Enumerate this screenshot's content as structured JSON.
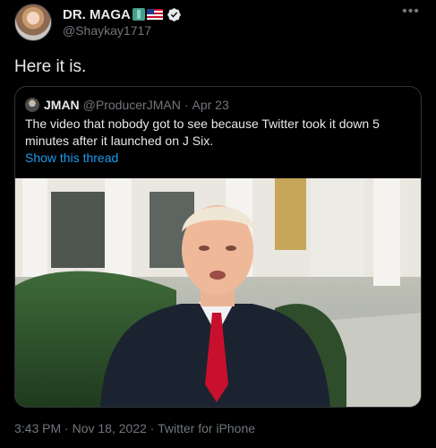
{
  "author": {
    "display_name": "DR. MAGA",
    "handle": "@Shaykay1717"
  },
  "tweet": {
    "text": "Here it is."
  },
  "quoted": {
    "name": "JMAN",
    "handle": "@ProducerJMAN",
    "separator": "·",
    "date": "Apr 23",
    "text": "The video that nobody got to see because Twitter took it down 5 minutes after it launched on J Six.",
    "show_thread": "Show this thread"
  },
  "meta": {
    "time": "3:43 PM",
    "separator": " · ",
    "date": "Nov 18, 2022",
    "source": "Twitter for iPhone"
  },
  "icons": {
    "more": "more-horizontal-icon",
    "verified": "verified-badge-icon",
    "flags": [
      "statue-of-liberty-icon",
      "us-flag-icon"
    ]
  },
  "colors": {
    "background": "#000000",
    "text": "#e7e9ea",
    "muted": "#71767b",
    "link": "#1d9bf0",
    "border": "#2f3336"
  }
}
